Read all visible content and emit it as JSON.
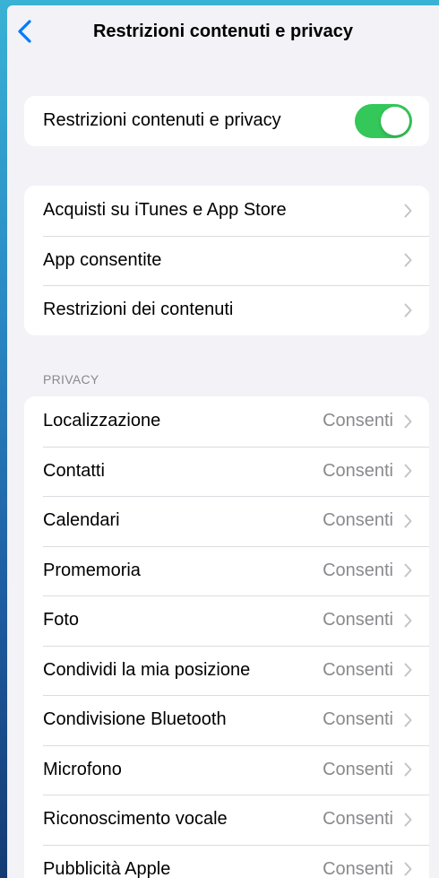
{
  "nav": {
    "title": "Restrizioni contenuti e privacy",
    "back_icon": "chevron-left-icon"
  },
  "master": {
    "label": "Restrizioni contenuti e privacy",
    "enabled": true,
    "toggle_color": "#34c759"
  },
  "store_group": {
    "items": [
      {
        "label": "Acquisti su iTunes e App Store"
      },
      {
        "label": "App consentite"
      },
      {
        "label": "Restrizioni dei contenuti"
      }
    ]
  },
  "privacy": {
    "header": "PRIVACY",
    "items": [
      {
        "label": "Localizzazione",
        "value": "Consenti"
      },
      {
        "label": "Contatti",
        "value": "Consenti"
      },
      {
        "label": "Calendari",
        "value": "Consenti"
      },
      {
        "label": "Promemoria",
        "value": "Consenti"
      },
      {
        "label": "Foto",
        "value": "Consenti"
      },
      {
        "label": "Condividi la mia posizione",
        "value": "Consenti"
      },
      {
        "label": "Condivisione Bluetooth",
        "value": "Consenti"
      },
      {
        "label": "Microfono",
        "value": "Consenti"
      },
      {
        "label": "Riconoscimento vocale",
        "value": "Consenti"
      },
      {
        "label": "Pubblicità Apple",
        "value": "Consenti"
      }
    ]
  },
  "colors": {
    "accent": "#007aff",
    "background": "#f2f2f7",
    "secondary_text": "#8a8a8e"
  }
}
